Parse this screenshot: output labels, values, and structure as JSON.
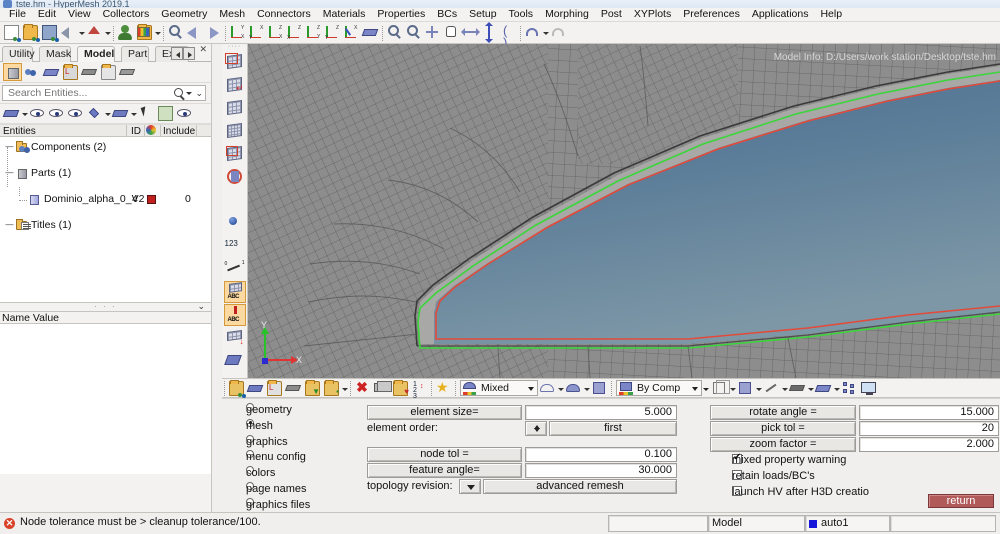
{
  "window": {
    "title": "tste.hm - HyperMesh 2019.1"
  },
  "menubar": {
    "items": [
      "File",
      "Edit",
      "View",
      "Collectors",
      "Geometry",
      "Mesh",
      "Connectors",
      "Materials",
      "Properties",
      "BCs",
      "Setup",
      "Tools",
      "Morphing",
      "Post",
      "XYPlots",
      "Preferences",
      "Applications",
      "Help"
    ]
  },
  "main_toolbar": {
    "icons": [
      "new-model-icon",
      "open-model-icon",
      "save-model-icon",
      "import-icon",
      "export-icon",
      "user-profile-icon",
      "load-user-profile-icon",
      "fit-view-icon",
      "previous-view-icon",
      "xy-view-icon",
      "yx-view-icon",
      "xz-view-icon",
      "zx-view-icon",
      "zy-view-icon",
      "yz-view-icon",
      "iso-view-icon",
      "normal-to-screen-icon",
      "zoom-in-icon",
      "zoom-out-icon",
      "zoom-window-icon",
      "pan-icon",
      "translate-horizontal-icon",
      "translate-vertical-icon",
      "rotate-icon",
      "undo-view-icon",
      "redo-view-icon"
    ]
  },
  "browser": {
    "tabs": [
      {
        "label": "Utility",
        "selected": false
      },
      {
        "label": "Mask",
        "selected": false
      },
      {
        "label": "Model",
        "selected": true
      },
      {
        "label": "Part",
        "selected": false
      },
      {
        "label": "Export",
        "selected": false
      }
    ],
    "entity_icons": [
      "assembly-icon",
      "connector-icon",
      "component-icon",
      "load-collector-icon",
      "system-icon",
      "property-icon",
      "material-icon"
    ],
    "display_icons": [
      "display-all-icon",
      "show-icon",
      "hide-icon",
      "reverse-icon",
      "isolate-icon",
      "isolate-only-icon",
      "select-cursor-icon",
      "highlight-icon",
      "visibility-eye-icon"
    ],
    "search": {
      "placeholder": "Search Entities...",
      "value": ""
    },
    "columns": [
      "Entities",
      "ID",
      "",
      "Include"
    ],
    "tree": [
      {
        "label": "Components (2)",
        "icon": "component-folder-icon",
        "indent": 1,
        "id": "",
        "include": ""
      },
      {
        "label": "Parts (1)",
        "icon": "part-folder-icon",
        "indent": 1,
        "id": "",
        "include": ""
      },
      {
        "label": "Dominio_alpha_0_V2",
        "icon": "part-icon",
        "indent": 2,
        "id": "4",
        "color": "#c02020",
        "include": "0"
      },
      {
        "label": "Titles (1)",
        "icon": "titles-folder-icon",
        "indent": 1,
        "id": "",
        "include": ""
      }
    ],
    "name_value_header": "Name Value"
  },
  "vertical_toolbar": {
    "icons": [
      "mesh-2d-icon",
      "mesh-3d-icon",
      "mesh-shrink-icon",
      "mesh-solid-icon",
      "mesh-select-icon",
      "circle-mask-icon",
      "binoculars-icon",
      "node-info-icon",
      "numbers-123-icon",
      "measure-icon",
      "text-abc-icon",
      "annotation-abc-icon",
      "image-capture-icon",
      "screen-capture-icon"
    ]
  },
  "viewport": {
    "model_info": "Model Info: D:/Users/work station/Desktop/tste.hm",
    "triad": {
      "x_label": "X",
      "y_label": "Y"
    },
    "background_color": "#8d8d8d",
    "surface_color": "#55708a",
    "feature_edge_green": "#3ad63a",
    "feature_edge_red": "#e34a3a"
  },
  "bottom_toolbar": {
    "left_icons": [
      "component-icon",
      "collector-icon",
      "load-collector-icon",
      "property-icon",
      "material-icon",
      "system-icon"
    ],
    "mid_icons": [
      "delete-icon",
      "mask-icon",
      "organize-icon",
      "renumber-icon",
      "favorites-star-icon"
    ],
    "element_mode": {
      "label": "Mixed",
      "icon": "mixed-shading-icon"
    },
    "shading_icons": [
      "wireframe-shaded-icon",
      "smooth-shaded-icon",
      "solid-shaded-icon"
    ],
    "color_mode": {
      "label": "By Comp",
      "icon": "color-by-comp-icon"
    },
    "right_icons": [
      "wireframe-cube-icon",
      "shaded-cube-icon",
      "line-display-icon",
      "shell-display-icon",
      "solid-display-icon",
      "node-display-icon",
      "monitor-icon"
    ]
  },
  "panel": {
    "radio_options": [
      {
        "label": "geometry",
        "selected": false
      },
      {
        "label": "mesh",
        "selected": true
      },
      {
        "label": "graphics",
        "selected": false
      },
      {
        "label": "menu config",
        "selected": false
      },
      {
        "label": "colors",
        "selected": false
      },
      {
        "label": "page names",
        "selected": false
      },
      {
        "label": "graphics files",
        "selected": false
      }
    ],
    "fields": [
      {
        "label": "element size=",
        "value": "5.000",
        "type": "button-field"
      },
      {
        "label": "element order:",
        "value": "first",
        "type": "spinner"
      },
      {
        "label": "node tol =",
        "value": "0.100",
        "type": "button-field"
      },
      {
        "label": "feature angle=",
        "value": "30.000",
        "type": "button-field"
      },
      {
        "label": "topology revision:",
        "value": "advanced remesh",
        "type": "dropdown"
      }
    ],
    "right_fields": [
      {
        "label": "rotate angle =",
        "value": "15.000"
      },
      {
        "label": "pick tol =",
        "value": "20"
      },
      {
        "label": "zoom factor =",
        "value": "2.000"
      }
    ],
    "checkboxes": [
      {
        "label": "mixed property warning",
        "checked": true
      },
      {
        "label": "retain loads/BC's",
        "checked": false
      },
      {
        "label": "launch HV after H3D creatio",
        "checked": false
      }
    ],
    "return_label": "return"
  },
  "statusbar": {
    "message": "Node tolerance must be > cleanup tolerance/100.",
    "error_icon": "error-icon",
    "field_empty": "",
    "field_model": "Model",
    "field_collector": "auto1",
    "collector_color": "#1616d8"
  }
}
